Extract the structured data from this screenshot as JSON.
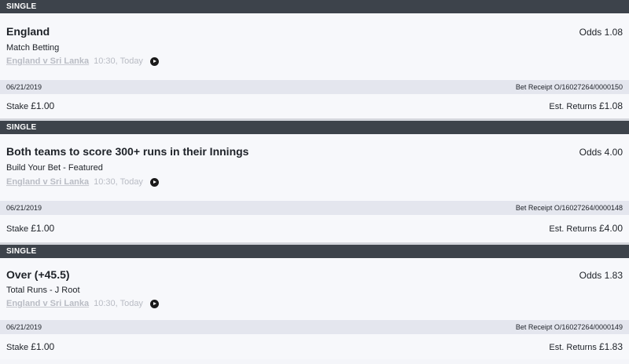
{
  "bets": [
    {
      "type": "SINGLE",
      "selection": "England",
      "odds_label": "Odds",
      "odds": "1.08",
      "market": "Match Betting",
      "event": "England v Sri Lanka",
      "time": "10:30, Today",
      "date": "06/21/2019",
      "receipt_label": "Bet Receipt",
      "receipt": "O/16027264/0000150",
      "stake_label": "Stake",
      "stake": "£1.00",
      "returns_label": "Est. Returns",
      "returns": "£1.08"
    },
    {
      "type": "SINGLE",
      "selection": "Both teams to score 300+ runs in their Innings",
      "odds_label": "Odds",
      "odds": "4.00",
      "market": "Build Your Bet - Featured",
      "event": "England v Sri Lanka",
      "time": "10:30, Today",
      "date": "06/21/2019",
      "receipt_label": "Bet Receipt",
      "receipt": "O/16027264/0000148",
      "stake_label": "Stake",
      "stake": "£1.00",
      "returns_label": "Est. Returns",
      "returns": "£4.00"
    },
    {
      "type": "SINGLE",
      "selection": "Over (+45.5)",
      "odds_label": "Odds",
      "odds": "1.83",
      "market": "Total Runs - J Root",
      "event": "England v Sri Lanka",
      "time": "10:30, Today",
      "date": "06/21/2019",
      "receipt_label": "Bet Receipt",
      "receipt": "O/16027264/0000149",
      "stake_label": "Stake",
      "stake": "£1.00",
      "returns_label": "Est. Returns",
      "returns": "£1.83"
    }
  ]
}
